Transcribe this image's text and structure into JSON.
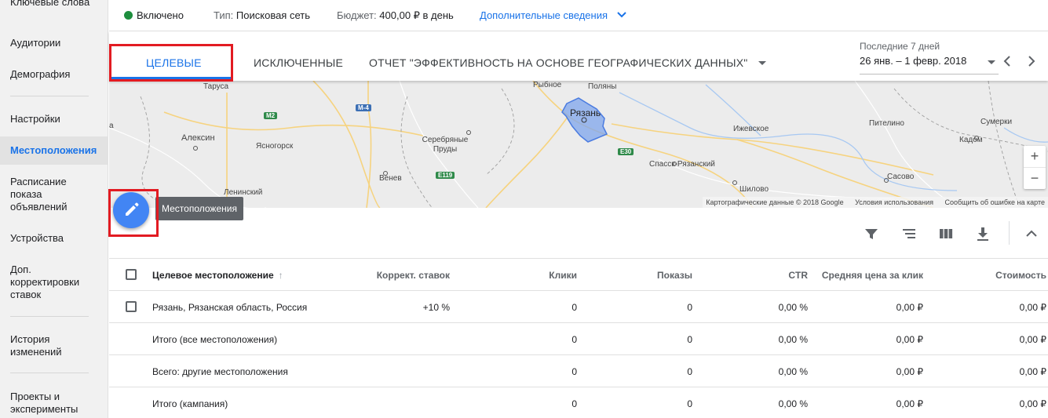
{
  "sidebar": {
    "items": [
      {
        "label": "Ключевые слова"
      },
      {
        "label": "Аудитории"
      },
      {
        "label": "Демография"
      },
      {
        "label": "Настройки"
      },
      {
        "label": "Местоположения",
        "active": true
      },
      {
        "label": "Расписание показа объявлений"
      },
      {
        "label": "Устройства"
      },
      {
        "label": "Доп. корректировки ставок"
      },
      {
        "label": "История изменений"
      },
      {
        "label": "Проекты и эксперименты"
      }
    ]
  },
  "status": {
    "state": "Включено",
    "type_label": "Тип:",
    "type_value": "Поисковая сеть",
    "budget_label": "Бюджет:",
    "budget_value": "400,00 ₽ в день",
    "details_link": "Дополнительные сведения"
  },
  "tabs": [
    {
      "label": "ЦЕЛЕВЫЕ",
      "active": true
    },
    {
      "label": "ИСКЛЮЧЕННЫЕ"
    },
    {
      "label": "ОТЧЕТ \"ЭФФЕКТИВНОСТЬ НА ОСНОВЕ ГЕОГРАФИЧЕСКИХ ДАННЫХ\""
    }
  ],
  "date_range": {
    "label": "Последние 7 дней",
    "value": "26 янв. – 1 февр. 2018"
  },
  "map": {
    "labels": [
      "Таруса",
      "Алексин",
      "Ясногорск",
      "Серебряные Пруды",
      "Венев",
      "Ленинский",
      "Рыбное",
      "Поляны",
      "Рязань",
      "Спасск-Рязанский",
      "Ижевское",
      "Шилово",
      "Пителино",
      "Сумерки",
      "Кадом",
      "Сасово",
      "а"
    ],
    "roads": [
      "M2",
      "M-4",
      "E119",
      "E30"
    ],
    "zoom_in": "+",
    "zoom_out": "−",
    "attribution": {
      "data": "Картографические данные © 2018 Google",
      "terms": "Условия использования",
      "report": "Сообщить об ошибке на карте"
    }
  },
  "fab": {
    "tooltip": "Местоположения",
    "icon": "pencil-icon"
  },
  "toolbar": {
    "icons": [
      "filter-icon",
      "segment-icon",
      "columns-icon",
      "download-icon",
      "collapse-icon"
    ]
  },
  "table": {
    "columns": [
      "Целевое местоположение",
      "Коррект. ставок",
      "Клики",
      "Показы",
      "CTR",
      "Средняя цена за клик",
      "Стоимость"
    ],
    "rows": [
      {
        "checkbox": true,
        "cells": [
          "Рязань, Рязанская область, Россия",
          "+10 %",
          "0",
          "0",
          "0,00 %",
          "0,00 ₽",
          "0,00 ₽"
        ]
      },
      {
        "checkbox": false,
        "cells": [
          "Итого (все местоположения)",
          "",
          "0",
          "0",
          "0,00 %",
          "0,00 ₽",
          "0,00 ₽"
        ]
      },
      {
        "checkbox": false,
        "cells": [
          "Всего: другие местоположения",
          "",
          "0",
          "0",
          "0,00 %",
          "0,00 ₽",
          "0,00 ₽"
        ]
      },
      {
        "checkbox": false,
        "cells": [
          "Итого (кампания)",
          "",
          "0",
          "0",
          "0,00 %",
          "0,00 ₽",
          "0,00 ₽"
        ]
      }
    ]
  },
  "colors": {
    "accent": "#1a73e8",
    "status_green": "#1e8e3e",
    "fab": "#4285f4",
    "highlight": "#e21b22"
  }
}
